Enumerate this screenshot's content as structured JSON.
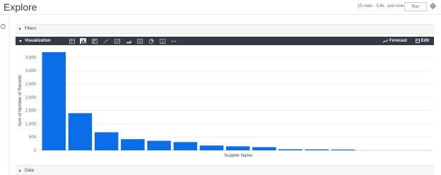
{
  "header": {
    "title": "Explore",
    "status": "15 rows · 0.9s · just now",
    "run_label": "Run"
  },
  "filters": {
    "label": "Filters"
  },
  "visualization": {
    "label": "Visualization",
    "icons": [
      "table-icon",
      "column-chart-icon",
      "bar-chart-icon",
      "scatter-icon",
      "line-icon",
      "area-icon",
      "map-icon",
      "pie-icon",
      "single-value-icon",
      "more-icon"
    ],
    "forecast_label": "Forecast",
    "edit_label": "Edit"
  },
  "data_section": {
    "label": "Data"
  },
  "chart_data": {
    "type": "bar",
    "xlabel": "Supplier Name",
    "ylabel": "Sum of Number of Records",
    "ylim": [
      0,
      3750
    ],
    "yticks": [
      "0",
      "500",
      "1,000",
      "1,500",
      "2,000",
      "2,500",
      "3,000",
      "3,500"
    ],
    "ytick_values": [
      0,
      500,
      1000,
      1500,
      2000,
      2500,
      3000,
      3500
    ],
    "values": [
      3700,
      1400,
      680,
      420,
      360,
      310,
      180,
      150,
      120,
      40,
      35,
      30
    ],
    "bar_color": "#0b6ee6",
    "grid": true
  }
}
